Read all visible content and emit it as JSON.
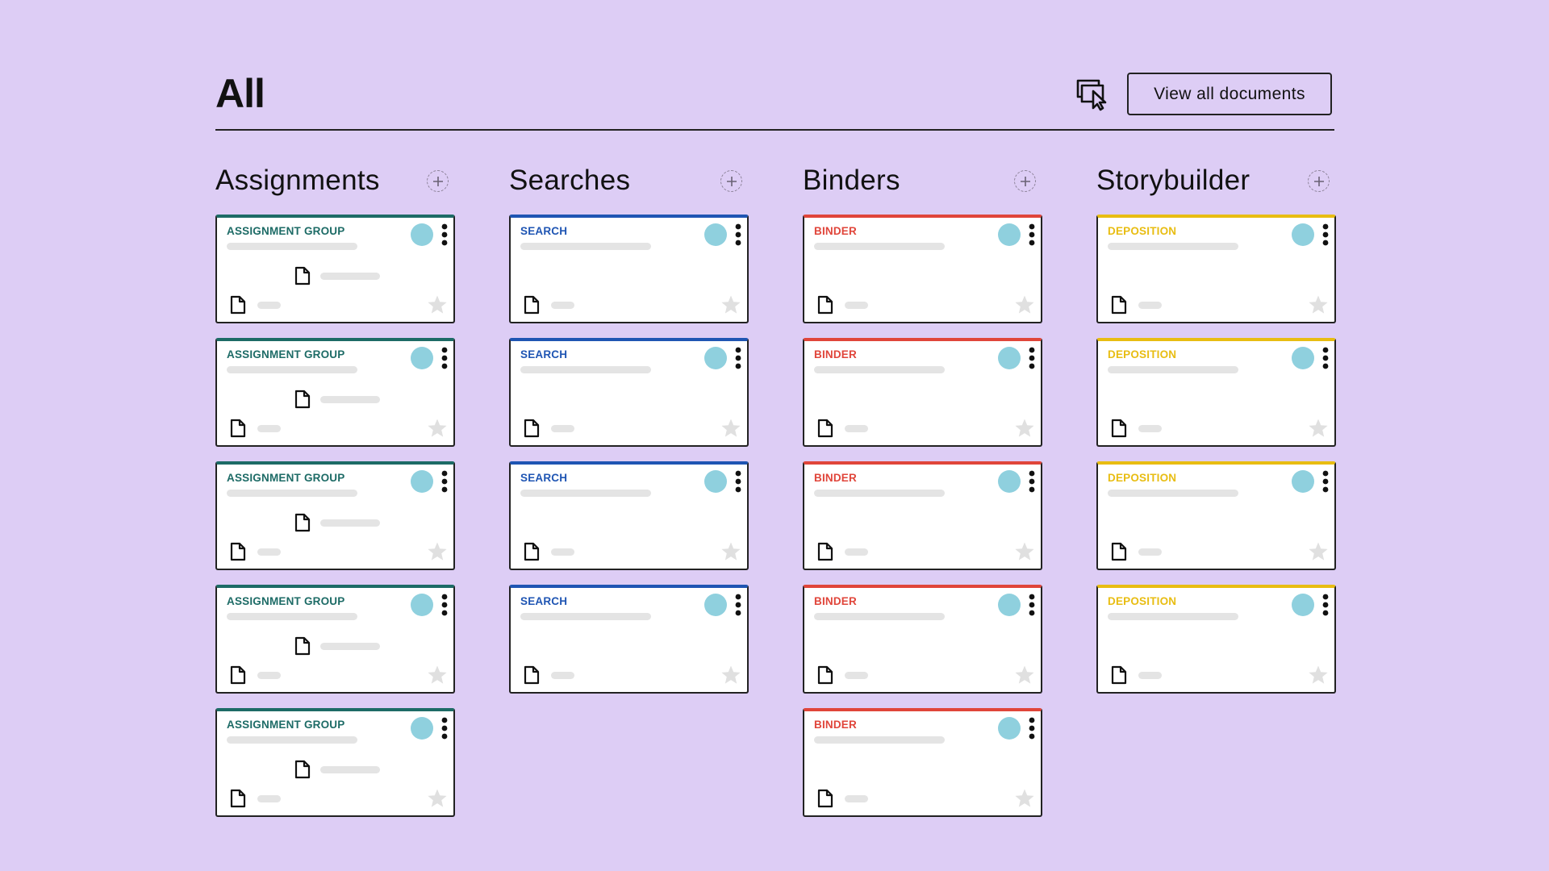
{
  "header": {
    "title": "All",
    "present_icon": "present-to-screen-icon",
    "view_all_label": "View all documents"
  },
  "colors": {
    "background": "#ddcdf5",
    "avatar": "#8fd0de",
    "placeholder": "#e4e4e4",
    "star": "#e0e0e0"
  },
  "columns": [
    {
      "key": "assignments",
      "title": "Assignments",
      "card_label": "ASSIGNMENT GROUP",
      "accent": "#1d6b66",
      "card_count": 5,
      "has_middle_row": true
    },
    {
      "key": "searches",
      "title": "Searches",
      "card_label": "SEARCH",
      "accent": "#1f55b3",
      "card_count": 4,
      "has_middle_row": false
    },
    {
      "key": "binders",
      "title": "Binders",
      "card_label": "BINDER",
      "accent": "#e0453a",
      "card_count": 5,
      "has_middle_row": false
    },
    {
      "key": "storybuilder",
      "title": "Storybuilder",
      "card_label": "DEPOSITION",
      "accent": "#e8bd12",
      "card_count": 4,
      "has_middle_row": false
    }
  ],
  "icons": {
    "add": "add-circle-icon",
    "menu": "more-vertical-icon",
    "document": "document-icon",
    "star": "star-icon"
  }
}
